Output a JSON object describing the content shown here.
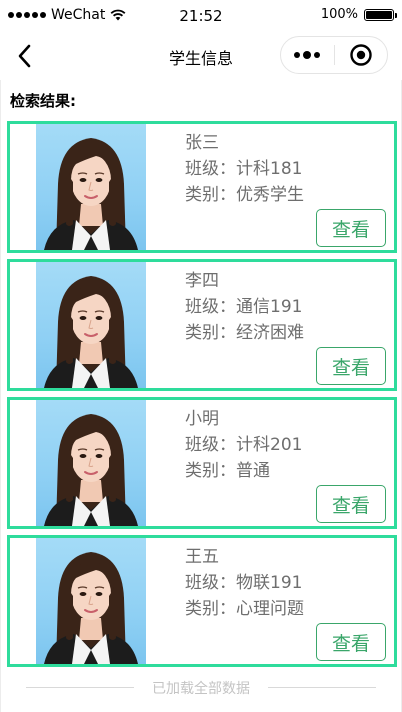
{
  "status_bar": {
    "carrier": "WeChat",
    "time": "21:52",
    "battery": "100%"
  },
  "nav": {
    "title": "学生信息"
  },
  "results_heading": "检索结果:",
  "view_label": "查看",
  "students": [
    {
      "name": "张三",
      "class_text": "班级：计科181",
      "type_text": "类别：优秀学生"
    },
    {
      "name": "李四",
      "class_text": "班级：通信191",
      "type_text": "类别：经济困难"
    },
    {
      "name": "小明",
      "class_text": "班级：计科201",
      "type_text": "类别：普通"
    },
    {
      "name": "王五",
      "class_text": "班级：物联191",
      "type_text": "类别：心理问题"
    }
  ],
  "footer_text": "已加载全部数据",
  "colors": {
    "card_border": "#2edc9c",
    "button_green": "#3aa66a",
    "info_text": "#6e6e6e"
  }
}
